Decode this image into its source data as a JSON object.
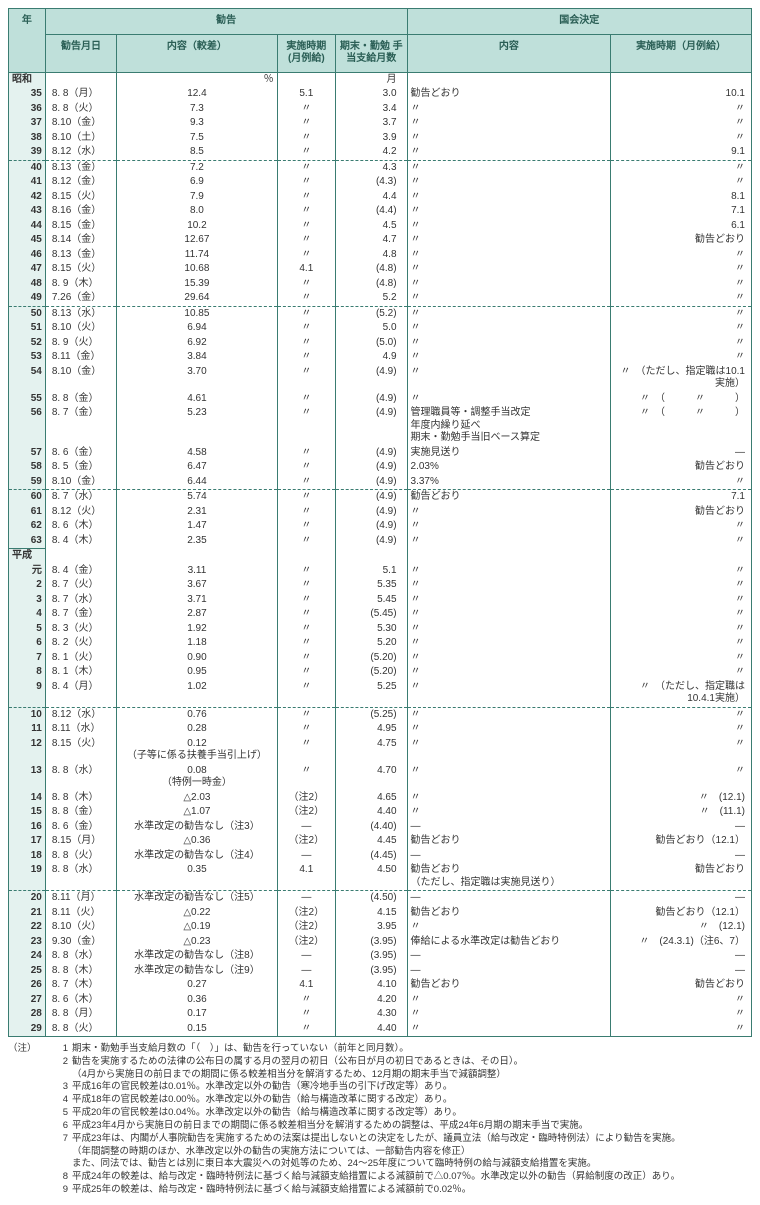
{
  "headers": {
    "year": "年",
    "group_rec": "勧告",
    "group_diet": "国会決定",
    "rec_date": "勧告月日",
    "rec_gap": "内容（較差）",
    "rec_impl": "実施時期\n(月例給)",
    "rec_months": "期末・勤勉\n手当支給月数",
    "diet_content": "内容",
    "diet_impl": "実施時期（月例給）"
  },
  "units": {
    "gap": "％",
    "months": "月"
  },
  "eras": [
    {
      "name": "昭和",
      "rows": [
        {
          "y": "35",
          "d": "8. 8（月）",
          "g": "12.4",
          "i": "5.1",
          "m": "3.0",
          "dc": "勧告どおり",
          "di": "10.1"
        },
        {
          "y": "36",
          "d": "8. 8（火）",
          "g": "7.3",
          "i": "〃",
          "m": "3.4",
          "dc": "〃",
          "di": "〃"
        },
        {
          "y": "37",
          "d": "8.10（金）",
          "g": "9.3",
          "i": "〃",
          "m": "3.7",
          "dc": "〃",
          "di": "〃"
        },
        {
          "y": "38",
          "d": "8.10（土）",
          "g": "7.5",
          "i": "〃",
          "m": "3.9",
          "dc": "〃",
          "di": "〃"
        },
        {
          "y": "39",
          "d": "8.12（水）",
          "g": "8.5",
          "i": "〃",
          "m": "4.2",
          "dc": "〃",
          "di": "9.1",
          "sep_after": true
        },
        {
          "y": "40",
          "d": "8.13（金）",
          "g": "7.2",
          "i": "〃",
          "m": "4.3",
          "dc": "〃",
          "di": "〃"
        },
        {
          "y": "41",
          "d": "8.12（金）",
          "g": "6.9",
          "i": "〃",
          "m": "(4.3)",
          "dc": "〃",
          "di": "〃"
        },
        {
          "y": "42",
          "d": "8.15（火）",
          "g": "7.9",
          "i": "〃",
          "m": "4.4",
          "dc": "〃",
          "di": "8.1"
        },
        {
          "y": "43",
          "d": "8.16（金）",
          "g": "8.0",
          "i": "〃",
          "m": "(4.4)",
          "dc": "〃",
          "di": "7.1"
        },
        {
          "y": "44",
          "d": "8.15（金）",
          "g": "10.2",
          "i": "〃",
          "m": "4.5",
          "dc": "〃",
          "di": "6.1"
        },
        {
          "y": "45",
          "d": "8.14（金）",
          "g": "12.67",
          "i": "〃",
          "m": "4.7",
          "dc": "〃",
          "di": "勧告どおり"
        },
        {
          "y": "46",
          "d": "8.13（金）",
          "g": "11.74",
          "i": "〃",
          "m": "4.8",
          "dc": "〃",
          "di": "〃"
        },
        {
          "y": "47",
          "d": "8.15（火）",
          "g": "10.68",
          "i": "4.1",
          "m": "(4.8)",
          "dc": "〃",
          "di": "〃"
        },
        {
          "y": "48",
          "d": "8. 9（木）",
          "g": "15.39",
          "i": "〃",
          "m": "(4.8)",
          "dc": "〃",
          "di": "〃"
        },
        {
          "y": "49",
          "d": "7.26（金）",
          "g": "29.64",
          "i": "〃",
          "m": "5.2",
          "dc": "〃",
          "di": "〃",
          "sep_after": true
        },
        {
          "y": "50",
          "d": "8.13（水）",
          "g": "10.85",
          "i": "〃",
          "m": "(5.2)",
          "dc": "〃",
          "di": "〃"
        },
        {
          "y": "51",
          "d": "8.10（火）",
          "g": "6.94",
          "i": "〃",
          "m": "5.0",
          "dc": "〃",
          "di": "〃"
        },
        {
          "y": "52",
          "d": "8. 9（火）",
          "g": "6.92",
          "i": "〃",
          "m": "(5.0)",
          "dc": "〃",
          "di": "〃"
        },
        {
          "y": "53",
          "d": "8.11（金）",
          "g": "3.84",
          "i": "〃",
          "m": "4.9",
          "dc": "〃",
          "di": "〃"
        },
        {
          "y": "54",
          "d": "8.10（金）",
          "g": "3.70",
          "i": "〃",
          "m": "(4.9)",
          "dc": "〃",
          "di": "〃　（ただし、指定職は10.1実施）"
        },
        {
          "y": "55",
          "d": "8. 8（金）",
          "g": "4.61",
          "i": "〃",
          "m": "(4.9)",
          "dc": "〃",
          "di": "〃　（　　　〃　　　）"
        },
        {
          "y": "56",
          "d": "8. 7（金）",
          "g": "5.23",
          "i": "〃",
          "m": "(4.9)",
          "dc": "管理職員等・調整手当改定\n年度内繰り延べ\n期末・勤勉手当旧ベース算定",
          "di": "〃　（　　　〃　　　）"
        },
        {
          "y": "57",
          "d": "8. 6（金）",
          "g": "4.58",
          "i": "〃",
          "m": "(4.9)",
          "dc": "実施見送り",
          "di": "—"
        },
        {
          "y": "58",
          "d": "8. 5（金）",
          "g": "6.47",
          "i": "〃",
          "m": "(4.9)",
          "dc": "2.03%",
          "di": "勧告どおり"
        },
        {
          "y": "59",
          "d": "8.10（金）",
          "g": "6.44",
          "i": "〃",
          "m": "(4.9)",
          "dc": "3.37%",
          "di": "〃",
          "sep_after": true
        },
        {
          "y": "60",
          "d": "8. 7（水）",
          "g": "5.74",
          "i": "〃",
          "m": "(4.9)",
          "dc": "勧告どおり",
          "di": "7.1"
        },
        {
          "y": "61",
          "d": "8.12（火）",
          "g": "2.31",
          "i": "〃",
          "m": "(4.9)",
          "dc": "〃",
          "di": "勧告どおり"
        },
        {
          "y": "62",
          "d": "8. 6（木）",
          "g": "1.47",
          "i": "〃",
          "m": "(4.9)",
          "dc": "〃",
          "di": "〃"
        },
        {
          "y": "63",
          "d": "8. 4（木）",
          "g": "2.35",
          "i": "〃",
          "m": "(4.9)",
          "dc": "〃",
          "di": "〃"
        }
      ]
    },
    {
      "name": "平成",
      "rows": [
        {
          "y": "元",
          "d": "8. 4（金）",
          "g": "3.11",
          "i": "〃",
          "m": "5.1",
          "dc": "〃",
          "di": "〃"
        },
        {
          "y": "2",
          "d": "8. 7（火）",
          "g": "3.67",
          "i": "〃",
          "m": "5.35",
          "dc": "〃",
          "di": "〃"
        },
        {
          "y": "3",
          "d": "8. 7（水）",
          "g": "3.71",
          "i": "〃",
          "m": "5.45",
          "dc": "〃",
          "di": "〃"
        },
        {
          "y": "4",
          "d": "8. 7（金）",
          "g": "2.87",
          "i": "〃",
          "m": "(5.45)",
          "dc": "〃",
          "di": "〃"
        },
        {
          "y": "5",
          "d": "8. 3（火）",
          "g": "1.92",
          "i": "〃",
          "m": "5.30",
          "dc": "〃",
          "di": "〃"
        },
        {
          "y": "6",
          "d": "8. 2（火）",
          "g": "1.18",
          "i": "〃",
          "m": "5.20",
          "dc": "〃",
          "di": "〃"
        },
        {
          "y": "7",
          "d": "8. 1（火）",
          "g": "0.90",
          "i": "〃",
          "m": "(5.20)",
          "dc": "〃",
          "di": "〃"
        },
        {
          "y": "8",
          "d": "8. 1（木）",
          "g": "0.95",
          "i": "〃",
          "m": "(5.20)",
          "dc": "〃",
          "di": "〃"
        },
        {
          "y": "9",
          "d": "8. 4（月）",
          "g": "1.02",
          "i": "〃",
          "m": "5.25",
          "dc": "〃",
          "di": "〃　（ただし、指定職は10.4.1実施）",
          "sep_after": true
        },
        {
          "y": "10",
          "d": "8.12（水）",
          "g": "0.76",
          "i": "〃",
          "m": "(5.25)",
          "dc": "〃",
          "di": "〃"
        },
        {
          "y": "11",
          "d": "8.11（水）",
          "g": "0.28",
          "i": "〃",
          "m": "4.95",
          "dc": "〃",
          "di": "〃"
        },
        {
          "y": "12",
          "d": "8.15（火）",
          "g": "0.12\n（子等に係る扶養手当引上げ）",
          "i": "〃",
          "m": "4.75",
          "dc": "〃",
          "di": "〃"
        },
        {
          "y": "13",
          "d": "8. 8（水）",
          "g": "0.08\n（特例一時金）",
          "i": "〃",
          "m": "4.70",
          "dc": "〃",
          "di": "〃"
        },
        {
          "y": "14",
          "d": "8. 8（木）",
          "g": "△2.03",
          "i": "（注2）",
          "m": "4.65",
          "dc": "〃",
          "di": "〃　(12.1)"
        },
        {
          "y": "15",
          "d": "8. 8（金）",
          "g": "△1.07",
          "i": "（注2）",
          "m": "4.40",
          "dc": "〃",
          "di": "〃　(11.1)"
        },
        {
          "y": "16",
          "d": "8. 6（金）",
          "g": "水準改定の勧告なし（注3）",
          "i": "—",
          "m": "(4.40)",
          "dc": "—",
          "di": "—"
        },
        {
          "y": "17",
          "d": "8.15（月）",
          "g": "△0.36",
          "i": "（注2）",
          "m": "4.45",
          "dc": "勧告どおり",
          "di": "勧告どおり（12.1）"
        },
        {
          "y": "18",
          "d": "8. 8（火）",
          "g": "水準改定の勧告なし（注4）",
          "i": "—",
          "m": "(4.45)",
          "dc": "—",
          "di": "—"
        },
        {
          "y": "19",
          "d": "8. 8（水）",
          "g": "0.35",
          "i": "4.1",
          "m": "4.50",
          "dc": "勧告どおり\n（ただし、指定職は実施見送り）",
          "di": "勧告どおり",
          "sep_after": true
        },
        {
          "y": "20",
          "d": "8.11（月）",
          "g": "水準改定の勧告なし（注5）",
          "i": "—",
          "m": "(4.50)",
          "dc": "—",
          "di": "—"
        },
        {
          "y": "21",
          "d": "8.11（火）",
          "g": "△0.22",
          "i": "（注2）",
          "m": "4.15",
          "dc": "勧告どおり",
          "di": "勧告どおり（12.1）"
        },
        {
          "y": "22",
          "d": "8.10（火）",
          "g": "△0.19",
          "i": "（注2）",
          "m": "3.95",
          "dc": "〃",
          "di": "〃　(12.1)"
        },
        {
          "y": "23",
          "d": "9.30（金）",
          "g": "△0.23",
          "i": "（注2）",
          "m": "(3.95)",
          "dc": "俸給による水準改定は勧告どおり",
          "di": "〃　(24.3.1)（注6、7）"
        },
        {
          "y": "24",
          "d": "8. 8（水）",
          "g": "水準改定の勧告なし（注8）",
          "i": "—",
          "m": "(3.95)",
          "dc": "—",
          "di": "—"
        },
        {
          "y": "25",
          "d": "8. 8（木）",
          "g": "水準改定の勧告なし（注9）",
          "i": "—",
          "m": "(3.95)",
          "dc": "—",
          "di": "—"
        },
        {
          "y": "26",
          "d": "8. 7（木）",
          "g": "0.27",
          "i": "4.1",
          "m": "4.10",
          "dc": "勧告どおり",
          "di": "勧告どおり"
        },
        {
          "y": "27",
          "d": "8. 6（木）",
          "g": "0.36",
          "i": "〃",
          "m": "4.20",
          "dc": "〃",
          "di": "〃"
        },
        {
          "y": "28",
          "d": "8. 8（月）",
          "g": "0.17",
          "i": "〃",
          "m": "4.30",
          "dc": "〃",
          "di": "〃"
        },
        {
          "y": "29",
          "d": "8. 8（火）",
          "g": "0.15",
          "i": "〃",
          "m": "4.40",
          "dc": "〃",
          "di": "〃"
        }
      ]
    }
  ],
  "notes_label": "（注）",
  "notes": [
    {
      "n": "1",
      "t": "期末・勤勉手当支給月数の「（　）」は、勧告を行っていない（前年と同月数）。"
    },
    {
      "n": "2",
      "t": "勧告を実施するための法律の公布日の属する月の翌月の初日（公布日が月の初日であるときは、その日）。\n（4月から実施日の前日までの期間に係る較差相当分を解消するため、12月期の期末手当で減額調整）"
    },
    {
      "n": "3",
      "t": "平成16年の官民較差は0.01％。水準改定以外の勧告（寒冷地手当の引下げ改定等）あり。"
    },
    {
      "n": "4",
      "t": "平成18年の官民較差は0.00％。水準改定以外の勧告（給与構造改革に関する改定）あり。"
    },
    {
      "n": "5",
      "t": "平成20年の官民較差は0.04％。水準改定以外の勧告（給与構造改革に関する改定等）あり。"
    },
    {
      "n": "6",
      "t": "平成23年4月から実施日の前日までの期間に係る較差相当分を解消するための調整は、平成24年6月期の期末手当で実施。"
    },
    {
      "n": "7",
      "t": "平成23年は、内閣が人事院勧告を実施するための法案は提出しないとの決定をしたが、議員立法（給与改定・臨時特例法）により勧告を実施。\n（年間調整の時期のほか、水準改定以外の勧告の実施方法については、一部勧告内容を修正）\nまた、同法では、勧告とは別に東日本大震災への対処等のため、24～25年度について臨時特例の給与減額支給措置を実施。"
    },
    {
      "n": "8",
      "t": "平成24年の較差は、給与改定・臨時特例法に基づく給与減額支給措置による減額前で△0.07％。水準改定以外の勧告（昇給制度の改正）あり。"
    },
    {
      "n": "9",
      "t": "平成25年の較差は、給与改定・臨時特例法に基づく給与減額支給措置による減額前で0.02％。"
    }
  ]
}
